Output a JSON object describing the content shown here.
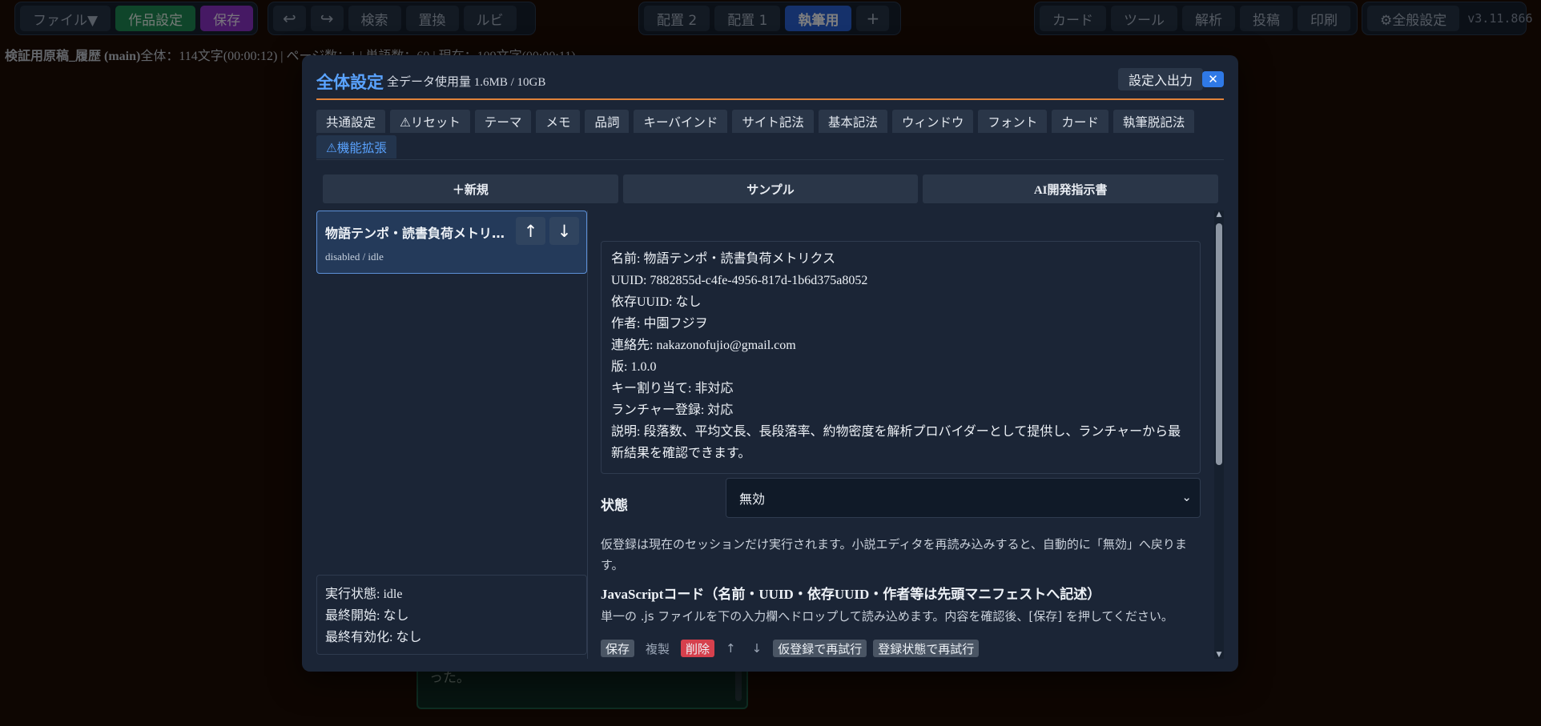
{
  "toolbar": {
    "group1": [
      "ファイル▼",
      "作品設定",
      "保存"
    ],
    "group2": [
      "↩",
      "↪",
      "検索",
      "置換",
      "ルビ"
    ],
    "group3": [
      "配置 2",
      "配置 1",
      "執筆用",
      "+"
    ],
    "group4": [
      "カード",
      "ツール",
      "解析",
      "投稿",
      "印刷"
    ],
    "settings_label": "⚙全般設定",
    "version": "v3.11.866"
  },
  "statusline": {
    "doc_name": "検証用原稿_履歴 (main)",
    "stats": "全体：114文字(00:00:12) | ページ数：1 | 単語数：60 | 現在：109文字(00:00:11)"
  },
  "background_editor": {
    "text": "った。"
  },
  "modal": {
    "title": "全体設定",
    "usage": "全データ使用量 1.6MB / 10GB",
    "io_button": "設定入出力",
    "close": "✕",
    "tabs": [
      {
        "label": "共通設定",
        "active": false
      },
      {
        "label": "⚠リセット",
        "active": false
      },
      {
        "label": "テーマ",
        "active": false
      },
      {
        "label": "メモ",
        "active": false
      },
      {
        "label": "品詞",
        "active": false
      },
      {
        "label": "キーバインド",
        "active": false
      },
      {
        "label": "サイト記法",
        "active": false
      },
      {
        "label": "基本記法",
        "active": false
      },
      {
        "label": "ウィンドウ",
        "active": false
      },
      {
        "label": "フォント",
        "active": false
      },
      {
        "label": "カード",
        "active": false
      },
      {
        "label": "執筆脱記法",
        "active": false
      },
      {
        "label": "⚠機能拡張",
        "active": true
      }
    ],
    "actions": [
      "＋新規",
      "サンプル",
      "AI開発指示書"
    ],
    "extension": {
      "list_title": "物語テンポ・読書負荷メトリクス",
      "list_status": "disabled / idle",
      "up": "↑",
      "down": "↓",
      "exec": {
        "state": "実行状態: idle",
        "last_start": "最終開始: なし",
        "last_enable": "最終有効化: なし"
      },
      "info": {
        "name": "名前: 物語テンポ・読書負荷メトリクス",
        "uuid": "UUID: 7882855d-c4fe-4956-817d-1b6d375a8052",
        "dep": "依存UUID: なし",
        "author": "作者: 中園フジヲ",
        "contact": "連絡先: nakazonofujio@gmail.com",
        "version": "版: 1.0.0",
        "keys": "キー割り当て: 非対応",
        "launcher": "ランチャー登録: 対応",
        "desc": "説明: 段落数、平均文長、長段落率、約物密度を解析プロバイダーとして提供し、ランチャーから最新結果を確認できます。"
      },
      "state_label": "状態",
      "state_value": "無効",
      "note": "仮登録は現在のセッションだけ実行されます。小説エディタを再読み込みすると、自動的に「無効」へ戻ります。",
      "js_heading": "JavaScriptコード（名前・UUID・依存UUID・作者等は先頭マニフェストへ記述）",
      "js_note": "単一の .js ファイルを下の入力欄へドロップして読み込めます。内容を確認後、[保存] を押してください。",
      "buttons": [
        "保存",
        "複製",
        "削除",
        "↑",
        "↓",
        "仮登録で再試行",
        "登録状態で再試行"
      ]
    }
  }
}
